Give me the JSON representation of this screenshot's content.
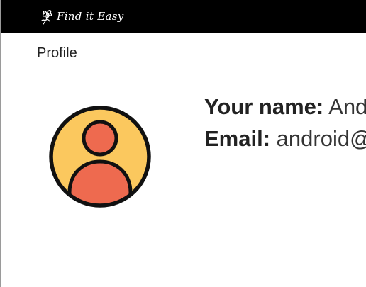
{
  "navbar": {
    "brand_name": "Find it Easy",
    "brand_icon": "flower-logo-icon"
  },
  "page": {
    "title": "Profile"
  },
  "avatar": {
    "icon": "user-avatar-icon",
    "colors": {
      "background": "#FBC85E",
      "figure": "#EE6A4F",
      "outline": "#111111"
    }
  },
  "profile": {
    "name_label": "Your name:",
    "name_value": "Andr",
    "email_label": "Email:",
    "email_value": "android@"
  },
  "colors": {
    "navbar_bg": "#000000",
    "page_bg": "#FFFFFF",
    "text": "#222222"
  }
}
